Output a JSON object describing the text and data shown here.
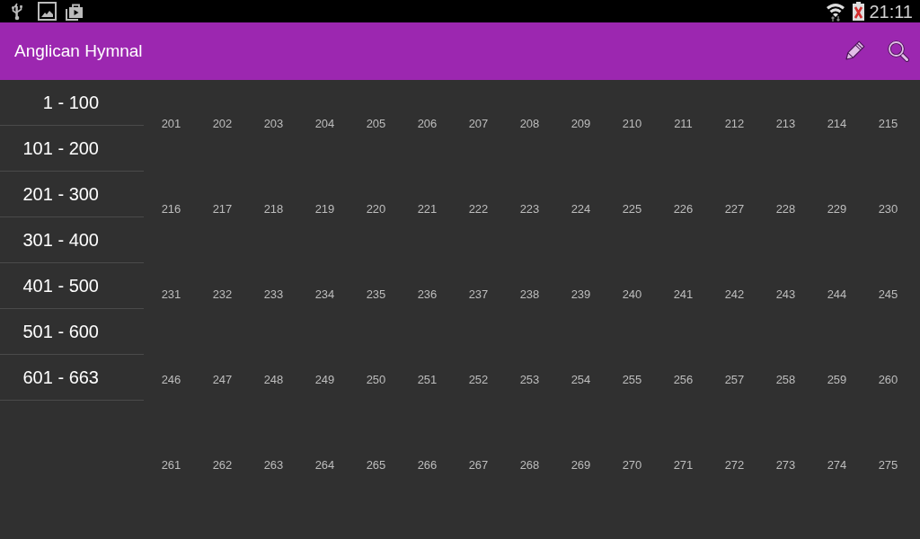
{
  "status_bar": {
    "time": "21:11"
  },
  "app_bar": {
    "title": "Anglican Hymnal"
  },
  "ranges": [
    "1 - 100",
    "101 - 200",
    "201 - 300",
    "301 - 400",
    "401 - 500",
    "501 - 600",
    "601 - 663"
  ],
  "hymns": [
    "201",
    "202",
    "203",
    "204",
    "205",
    "206",
    "207",
    "208",
    "209",
    "210",
    "211",
    "212",
    "213",
    "214",
    "215",
    "216",
    "217",
    "218",
    "219",
    "220",
    "221",
    "222",
    "223",
    "224",
    "225",
    "226",
    "227",
    "228",
    "229",
    "230",
    "231",
    "232",
    "233",
    "234",
    "235",
    "236",
    "237",
    "238",
    "239",
    "240",
    "241",
    "242",
    "243",
    "244",
    "245",
    "246",
    "247",
    "248",
    "249",
    "250",
    "251",
    "252",
    "253",
    "254",
    "255",
    "256",
    "257",
    "258",
    "259",
    "260",
    "261",
    "262",
    "263",
    "264",
    "265",
    "266",
    "267",
    "268",
    "269",
    "270",
    "271",
    "272",
    "273",
    "274",
    "275"
  ]
}
